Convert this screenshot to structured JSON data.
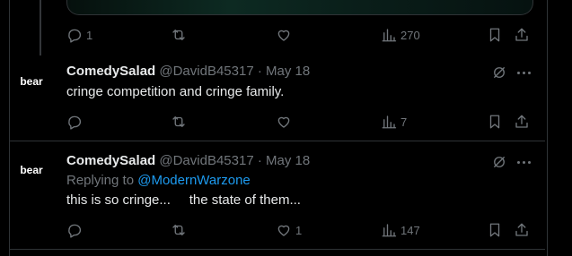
{
  "tweets": [
    {
      "stats": {
        "replies": "1",
        "reposts": "",
        "likes": "",
        "views": "270"
      }
    },
    {
      "avatar_label": "bear",
      "name": "ComedySalad",
      "handle": "@DavidB45317",
      "dot": "·",
      "date": "May 18",
      "text": "cringe competition and cringe family.",
      "stats": {
        "replies": "",
        "reposts": "",
        "likes": "",
        "views": "7"
      }
    },
    {
      "avatar_label": "bear",
      "name": "ComedySalad",
      "handle": "@DavidB45317",
      "dot": "·",
      "date": "May 18",
      "replying_prefix": "Replying to",
      "replying_to": "@ModernWarzone",
      "text": "this is so cringe...     the state of them...",
      "stats": {
        "replies": "",
        "reposts": "",
        "likes": "1",
        "views": "147"
      }
    }
  ],
  "icons": [
    "reply-icon",
    "repost-icon",
    "like-icon",
    "views-icon",
    "bookmark-icon",
    "share-icon",
    "grok-icon",
    "more-icon"
  ],
  "colors": {
    "background": "#000000",
    "text": "#e7e9ea",
    "muted": "#71767b",
    "link": "#1d9bf0",
    "border": "#2f3336"
  }
}
